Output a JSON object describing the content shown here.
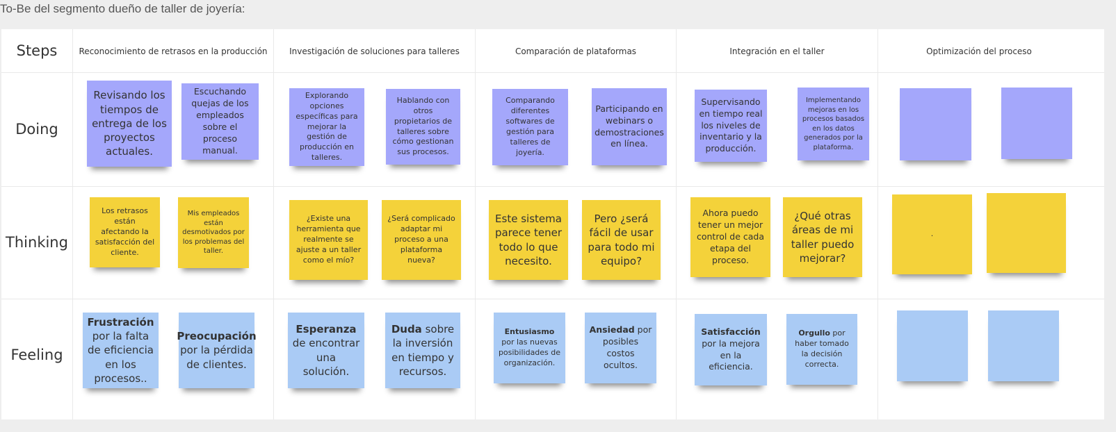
{
  "page_title": "To-Be del segmento dueño de taller de joyería:",
  "row_labels": {
    "steps": "Steps",
    "doing": "Doing",
    "thinking": "Thinking",
    "feeling": "Feeling"
  },
  "steps": [
    "Reconocimiento de retrasos en la producción",
    "Investigación de soluciones para talleres",
    "Comparación de plataformas",
    "Integración en el taller",
    "Optimización del proceso"
  ],
  "doing": [
    "Revisando los tiempos de entrega de los proyectos actuales.",
    "Escuchando quejas de los empleados sobre el proceso manual.",
    "Explorando opciones específicas para mejorar la gestión de producción en talleres.",
    "Hablando con otros propietarios de talleres sobre cómo gestionan sus procesos.",
    "Comparando diferentes softwares de gestión para talleres de joyería.",
    "Participando en webinars o demostraciones en línea.",
    "Supervisando en tiempo real los niveles de inventario y la producción.",
    "Implementando mejoras en los procesos basados en los datos generados por la plataforma.",
    "",
    ""
  ],
  "thinking": [
    "Los retrasos están afectando la satisfacción del cliente.",
    "Mis empleados están desmotivados por los problemas del taller.",
    "¿Existe una herramienta que realmente se ajuste a un taller como el mío?",
    "¿Será complicado adaptar mi proceso a una plataforma nueva?",
    "Este sistema parece tener todo lo que necesito.",
    "Pero ¿será fácil de usar para todo mi equipo?",
    "Ahora puedo tener un mejor control de cada etapa del proceso.",
    "¿Qué otras áreas de mi taller puedo mejorar?",
    ".",
    ""
  ],
  "feeling": [
    {
      "bold": "Frustración",
      "rest": " por la falta de eficiencia en los procesos.."
    },
    {
      "bold": "Preocupación",
      "rest": " por la pérdida de clientes."
    },
    {
      "bold": "Esperanza",
      "rest": " de encontrar una solución."
    },
    {
      "bold": "Duda",
      "rest": " sobre la inversión en tiempo y recursos."
    },
    {
      "bold": "Entusiasmo",
      "rest": " por las nuevas posibilidades de organización."
    },
    {
      "bold": "Ansiedad",
      "rest": " por posibles costos ocultos."
    },
    {
      "bold": "Satisfacción",
      "rest": " por la mejora en la eficiencia."
    },
    {
      "bold": "Orgullo",
      "rest": " por haber tomado la decisión correcta."
    },
    {
      "bold": "",
      "rest": ""
    },
    {
      "bold": "",
      "rest": ""
    }
  ],
  "colors": {
    "doing": "#a4a7fb",
    "thinking": "#f4d23a",
    "feeling": "#aacbf5"
  }
}
